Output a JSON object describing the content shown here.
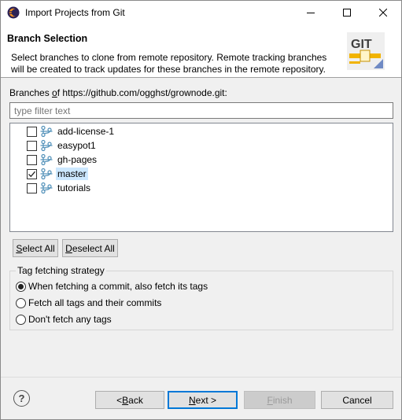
{
  "window": {
    "title": "Import Projects from Git",
    "icons": {
      "app": "eclipse-icon",
      "minimize": "minimize-icon",
      "maximize": "maximize-icon",
      "close": "close-icon"
    }
  },
  "header": {
    "title": "Branch Selection",
    "description": "Select branches to clone from remote repository. Remote tracking branches will be created to track updates for these branches in the remote repository.",
    "logo_text": "GIT"
  },
  "branches_section": {
    "label_prefix": "Branches ",
    "label_mnemonic": "o",
    "label_rest": "f https://github.com/ogghst/grownode.git:",
    "filter_placeholder": "type filter text",
    "filter_value": ""
  },
  "branches": [
    {
      "name": "add-license-1",
      "checked": false,
      "selected": false
    },
    {
      "name": "easypot1",
      "checked": false,
      "selected": false
    },
    {
      "name": "gh-pages",
      "checked": false,
      "selected": false
    },
    {
      "name": "master",
      "checked": true,
      "selected": true
    },
    {
      "name": "tutorials",
      "checked": false,
      "selected": false
    }
  ],
  "selection_buttons": {
    "select_all_mnemonic": "S",
    "select_all_rest": "elect All",
    "deselect_all_mnemonic": "D",
    "deselect_all_rest": "eselect All"
  },
  "tag_strategy": {
    "label": "Tag fetching strategy",
    "options": [
      {
        "label": "When fetching a commit, also fetch its tags",
        "selected": true
      },
      {
        "label": "Fetch all tags and their commits",
        "selected": false
      },
      {
        "label": "Don't fetch any tags",
        "selected": false
      }
    ]
  },
  "footer": {
    "help_glyph": "?",
    "back_pre": "< ",
    "back_mnemonic": "B",
    "back_rest": "ack",
    "next_mnemonic": "N",
    "next_rest": "ext >",
    "finish_mnemonic": "F",
    "finish_rest": "inish",
    "cancel": "Cancel"
  },
  "colors": {
    "accent": "#0078d7",
    "selection": "#cce8ff",
    "branch_icon": "#4f8fb8",
    "git_logo_bg": "#efefef",
    "git_text": "#3e3e3e",
    "git_bar": "#f1b300"
  }
}
